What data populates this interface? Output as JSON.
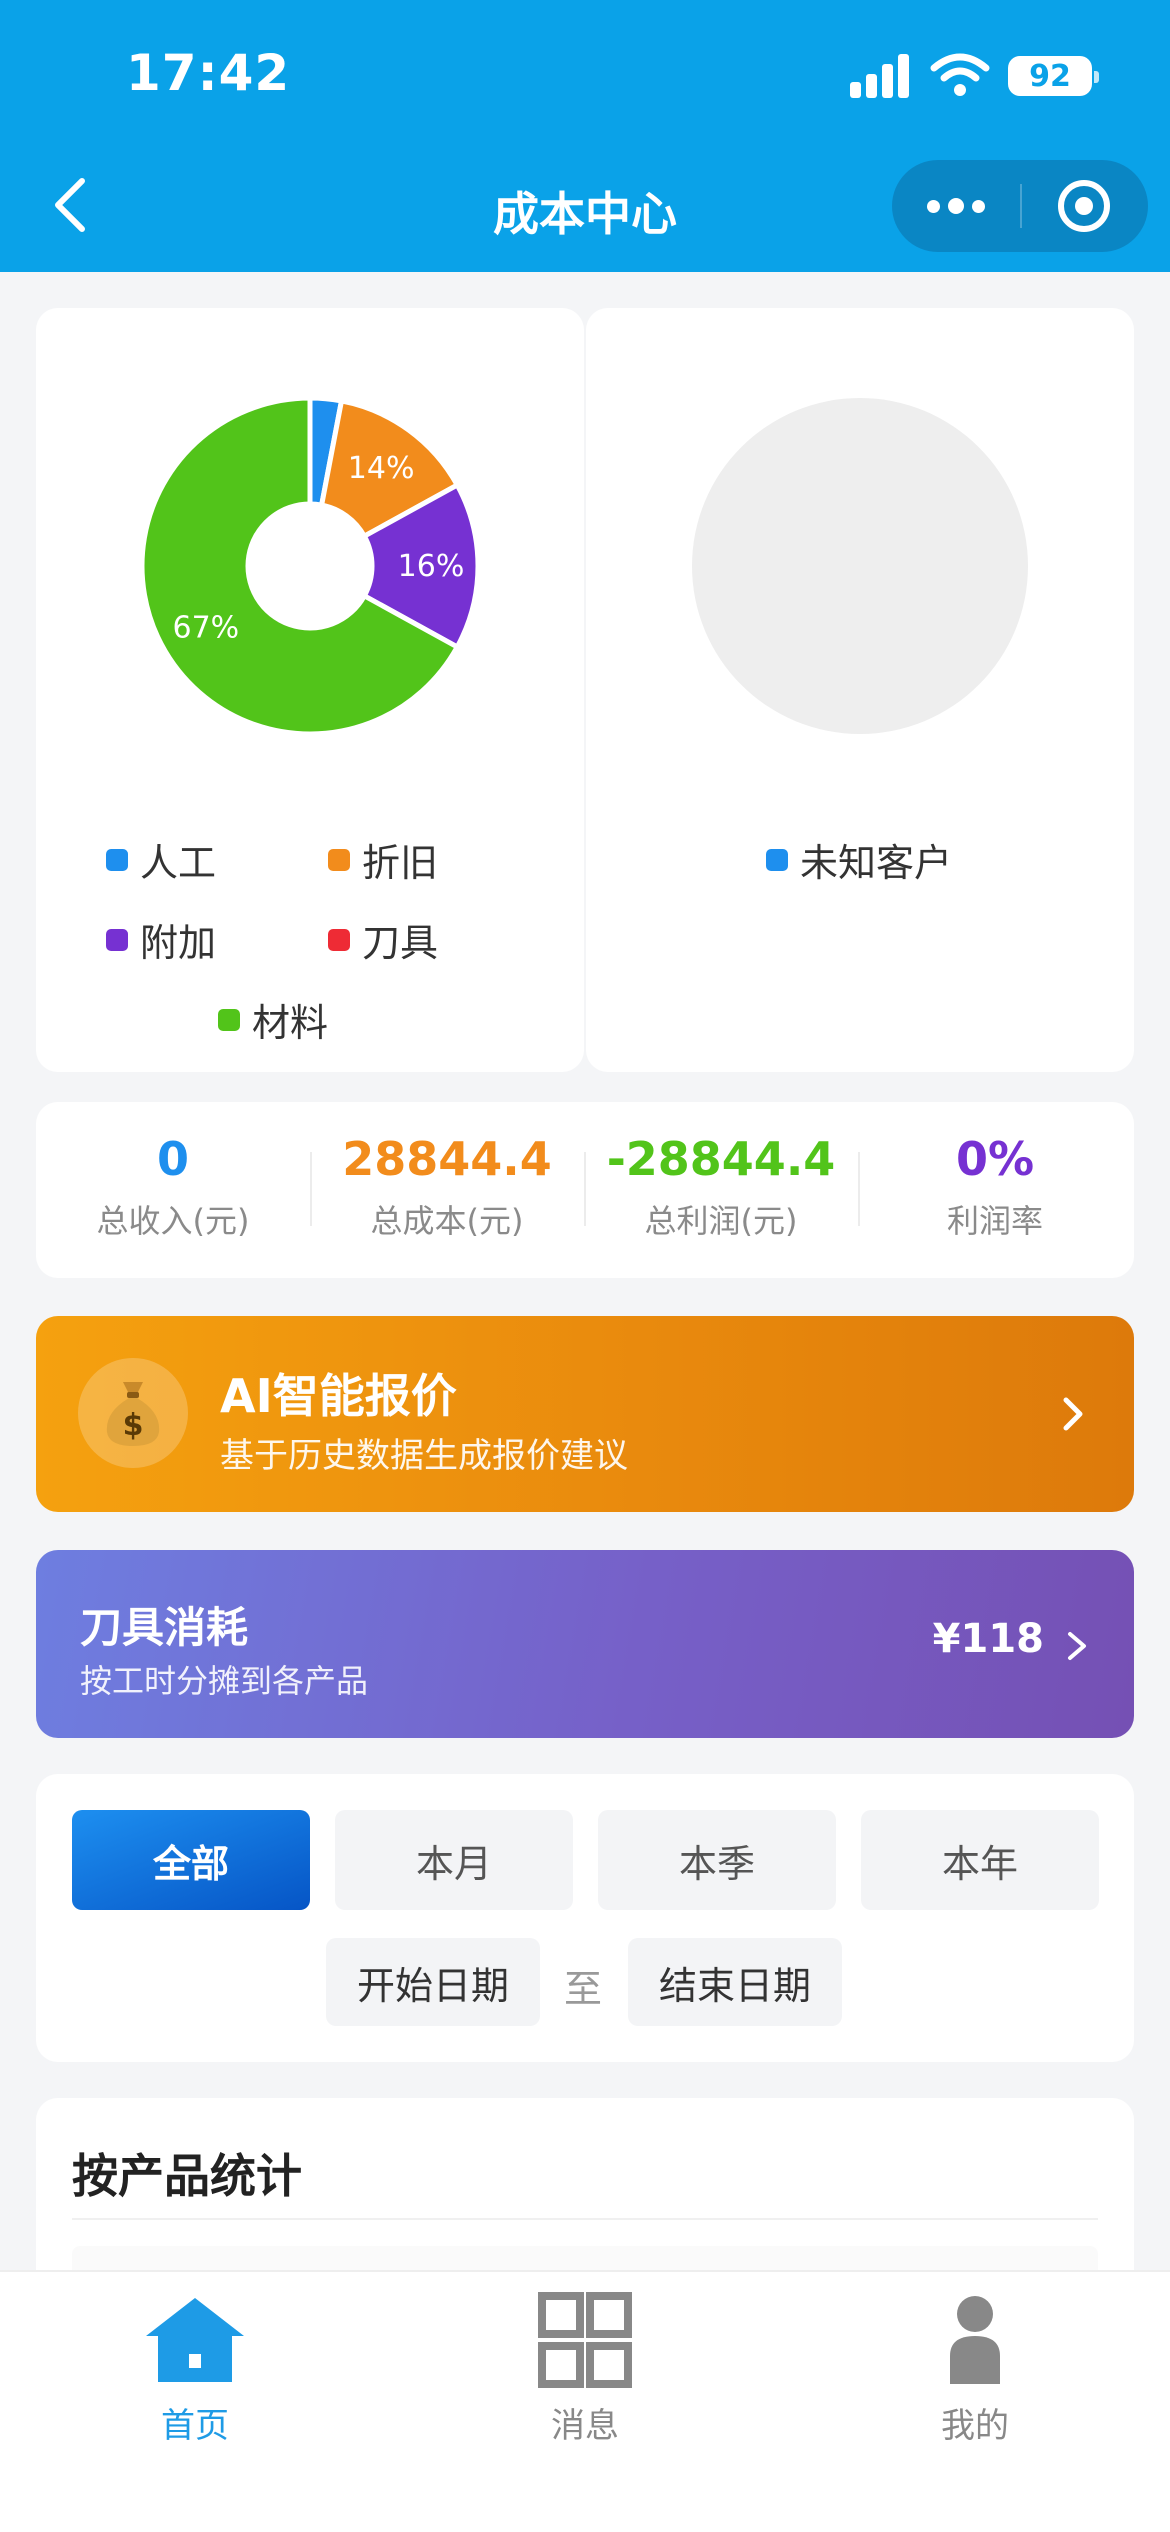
{
  "status_bar": {
    "time": "17:42",
    "battery": "92"
  },
  "header": {
    "title": "成本中心"
  },
  "pie_left": {
    "segments": [
      {
        "name": "人工",
        "value": 3,
        "color": "#1e8fee",
        "label": ""
      },
      {
        "name": "折旧",
        "value": 14,
        "color": "#f28c1c",
        "label": "14%"
      },
      {
        "name": "附加",
        "value": 16,
        "color": "#7631d2",
        "label": "16%"
      },
      {
        "name": "刀具",
        "value": 0,
        "color": "#ee2b35",
        "label": ""
      },
      {
        "name": "材料",
        "value": 67,
        "color": "#52c41a",
        "label": "67%"
      }
    ]
  },
  "pie_right": {
    "segments": [
      {
        "name": "未知客户",
        "value": 100,
        "color": "#1e8fee"
      }
    ],
    "fill": "#eeeeee"
  },
  "stats": [
    {
      "value": "0",
      "label": "总收入(元)",
      "color": "#1e8fee"
    },
    {
      "value": "28844.4",
      "label": "总成本(元)",
      "color": "#f28c1c"
    },
    {
      "value": "-28844.4",
      "label": "总利润(元)",
      "color": "#52c41a"
    },
    {
      "value": "0%",
      "label": "利润率",
      "color": "#7631d2"
    }
  ],
  "ai_banner": {
    "title": "AI智能报价",
    "subtitle": "基于历史数据生成报价建议"
  },
  "tool_banner": {
    "title": "刀具消耗",
    "subtitle": "按工时分摊到各产品",
    "amount": "¥118"
  },
  "filters": {
    "periods": [
      "全部",
      "本月",
      "本季",
      "本年"
    ],
    "start_date": "开始日期",
    "separator": "至",
    "end_date": "结束日期"
  },
  "product_section": {
    "title": "按产品统计"
  },
  "tabbar": {
    "items": [
      {
        "label": "首页",
        "icon": "home-icon"
      },
      {
        "label": "消息",
        "icon": "grid-icon"
      },
      {
        "label": "我的",
        "icon": "user-icon"
      }
    ],
    "active_color": "#1e9be6",
    "inactive_color": "#888888"
  }
}
